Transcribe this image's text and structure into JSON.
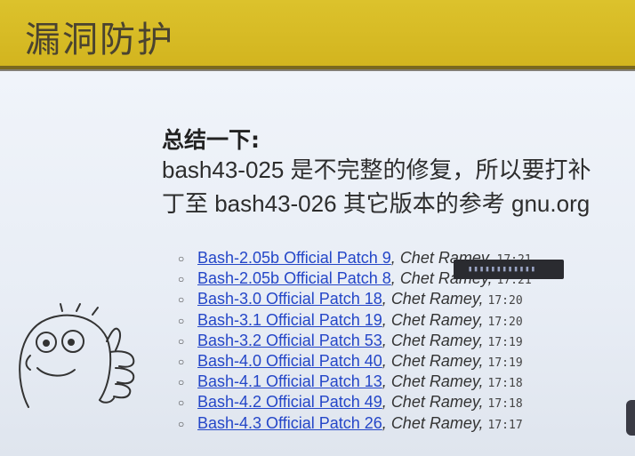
{
  "header": {
    "title": "漏洞防护"
  },
  "summary": {
    "heading": "总结一下:",
    "line1": "bash43-025 是不完整的修复，所以要打补",
    "line2": "丁至 bash43-026 其它版本的参考 gnu.org"
  },
  "patches": [
    {
      "link": "Bash-2.05b Official Patch 9",
      "author": "Chet Ramey",
      "time": "17:21"
    },
    {
      "link": "Bash-2.05b Official Patch 8",
      "author": "Chet Ramey",
      "time": "17:21"
    },
    {
      "link": "Bash-3.0 Official Patch 18",
      "author": "Chet Ramey",
      "time": "17:20"
    },
    {
      "link": "Bash-3.1 Official Patch 19",
      "author": "Chet Ramey",
      "time": "17:20"
    },
    {
      "link": "Bash-3.2 Official Patch 53",
      "author": "Chet Ramey",
      "time": "17:19"
    },
    {
      "link": "Bash-4.0 Official Patch 40",
      "author": "Chet Ramey",
      "time": "17:19"
    },
    {
      "link": "Bash-4.1 Official Patch 13",
      "author": "Chet Ramey",
      "time": "17:18"
    },
    {
      "link": "Bash-4.2 Official Patch 49",
      "author": "Chet Ramey",
      "time": "17:18"
    },
    {
      "link": "Bash-4.3 Official Patch 26",
      "author": "Chet Ramey",
      "time": "17:17"
    }
  ],
  "colors": {
    "header": "#d6ba22",
    "link": "#2446c8"
  }
}
